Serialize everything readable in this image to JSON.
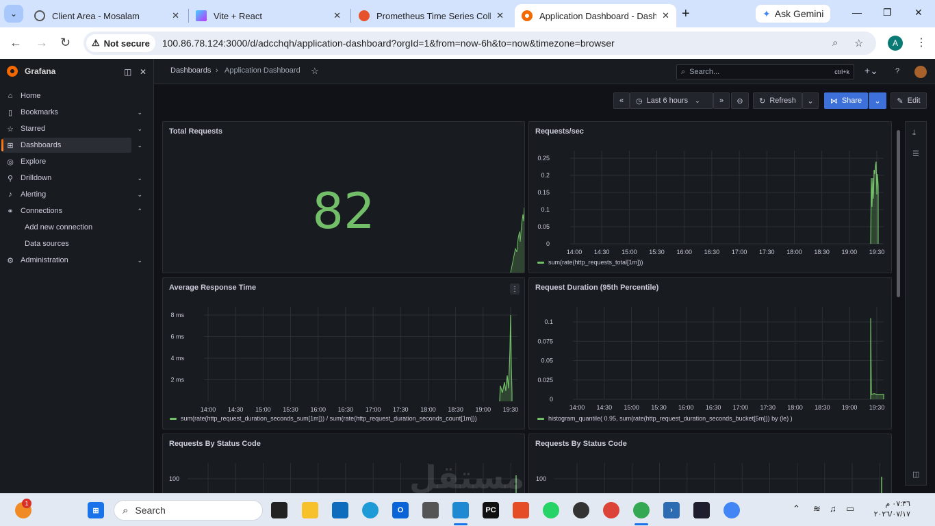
{
  "browser": {
    "tabs": [
      {
        "title": "Client Area - Mosalam",
        "icon": "globe-icon"
      },
      {
        "title": "Vite + React",
        "icon": "vite-icon"
      },
      {
        "title": "Prometheus Time Series Collect",
        "icon": "prometheus-icon"
      },
      {
        "title": "Application Dashboard - Dashb",
        "icon": "grafana-icon",
        "active": true
      }
    ],
    "ask_gemini": "Ask Gemini",
    "not_secure": "Not secure",
    "url": "100.86.78.124:3000/d/adcchqh/application-dashboard?orgId=1&from=now-6h&to=now&timezone=browser",
    "profile_initial": "A"
  },
  "grafana": {
    "brand": "Grafana",
    "nav": [
      {
        "label": "Home",
        "icon": "home-icon"
      },
      {
        "label": "Bookmarks",
        "icon": "bookmark-icon"
      },
      {
        "label": "Starred",
        "icon": "star-icon"
      },
      {
        "label": "Dashboards",
        "icon": "apps-icon"
      },
      {
        "label": "Explore",
        "icon": "compass-icon"
      },
      {
        "label": "Drilldown",
        "icon": "drilldown-icon"
      },
      {
        "label": "Alerting",
        "icon": "bell-icon"
      },
      {
        "label": "Connections",
        "icon": "connections-icon"
      },
      {
        "label": "Administration",
        "icon": "cog-icon"
      }
    ],
    "connections_sub": [
      "Add new connection",
      "Data sources"
    ],
    "breadcrumb": {
      "root": "Dashboards",
      "current": "Application Dashboard"
    },
    "search_placeholder": "Search...",
    "search_shortcut": "ctrl+k",
    "toolbar": {
      "time_range": "Last 6 hours",
      "refresh": "Refresh",
      "share": "Share",
      "edit": "Edit"
    },
    "colors": {
      "series": "#73bf69",
      "accent": "#f46800",
      "primary": "#3d71d9"
    }
  },
  "panels": {
    "total_requests": {
      "title": "Total Requests",
      "value": "82"
    },
    "requests_sec": {
      "title": "Requests/sec",
      "legend": "sum(rate(http_requests_total[1m]))"
    },
    "avg_response": {
      "title": "Average Response Time",
      "legend": "sum(rate(http_request_duration_seconds_sum[1m])) / sum(rate(http_request_duration_seconds_count[1m]))"
    },
    "p95": {
      "title": "Request Duration (95th Percentile)",
      "legend": "histogram_quantile( 0.95, sum(rate(http_request_duration_seconds_bucket[5m])) by (le) )"
    },
    "status_a": {
      "title": "Requests By Status Code"
    },
    "status_b": {
      "title": "Requests By Status Code"
    }
  },
  "chart_data": [
    {
      "type": "line",
      "title": "Requests/sec",
      "x": [
        "14:00",
        "14:30",
        "15:00",
        "15:30",
        "16:00",
        "16:30",
        "17:00",
        "17:30",
        "18:00",
        "18:30",
        "19:00",
        "19:30"
      ],
      "yticks": [
        "0.25",
        "0.2",
        "0.15",
        "0.1",
        "0.05",
        "0"
      ],
      "ylim": [
        0,
        0.25
      ],
      "series": [
        {
          "name": "sum(rate(http_requests_total[1m]))",
          "values": [
            0,
            0,
            0,
            0,
            0,
            0,
            0,
            0,
            0,
            0,
            0,
            0.24
          ]
        }
      ]
    },
    {
      "type": "line",
      "title": "Average Response Time",
      "x": [
        "14:00",
        "14:30",
        "15:00",
        "15:30",
        "16:00",
        "16:30",
        "17:00",
        "17:30",
        "18:00",
        "18:30",
        "19:00",
        "19:30"
      ],
      "yticks": [
        "8 ms",
        "6 ms",
        "4 ms",
        "2 ms"
      ],
      "ylim": [
        0,
        8
      ],
      "series": [
        {
          "name": "sum(rate(http_request_duration_seconds_sum[1m])) / sum(rate(http_request_duration_seconds_count[1m]))",
          "values": [
            0,
            0,
            0,
            0,
            0,
            0,
            0,
            0,
            0,
            0,
            0,
            8
          ]
        }
      ]
    },
    {
      "type": "line",
      "title": "Request Duration (95th Percentile)",
      "x": [
        "14:00",
        "14:30",
        "15:00",
        "15:30",
        "16:00",
        "16:30",
        "17:00",
        "17:30",
        "18:00",
        "18:30",
        "19:00",
        "19:30"
      ],
      "yticks": [
        "0.1",
        "0.075",
        "0.05",
        "0.025",
        "0"
      ],
      "ylim": [
        0,
        0.1
      ],
      "series": [
        {
          "name": "histogram_quantile( 0.95, sum(rate(http_request_duration_seconds_bucket[5m])) by (le) )",
          "values": [
            0,
            0,
            0,
            0,
            0,
            0,
            0,
            0,
            0,
            0,
            0,
            0.105
          ]
        }
      ]
    },
    {
      "type": "line",
      "title": "Requests By Status Code",
      "yticks": [
        "100"
      ]
    }
  ],
  "taskbar": {
    "search": "Search",
    "notification_badge": "1",
    "clock_time": "٠٧:٣٦ م",
    "clock_date": "٢٠٢٦/٠٧/١٧"
  }
}
